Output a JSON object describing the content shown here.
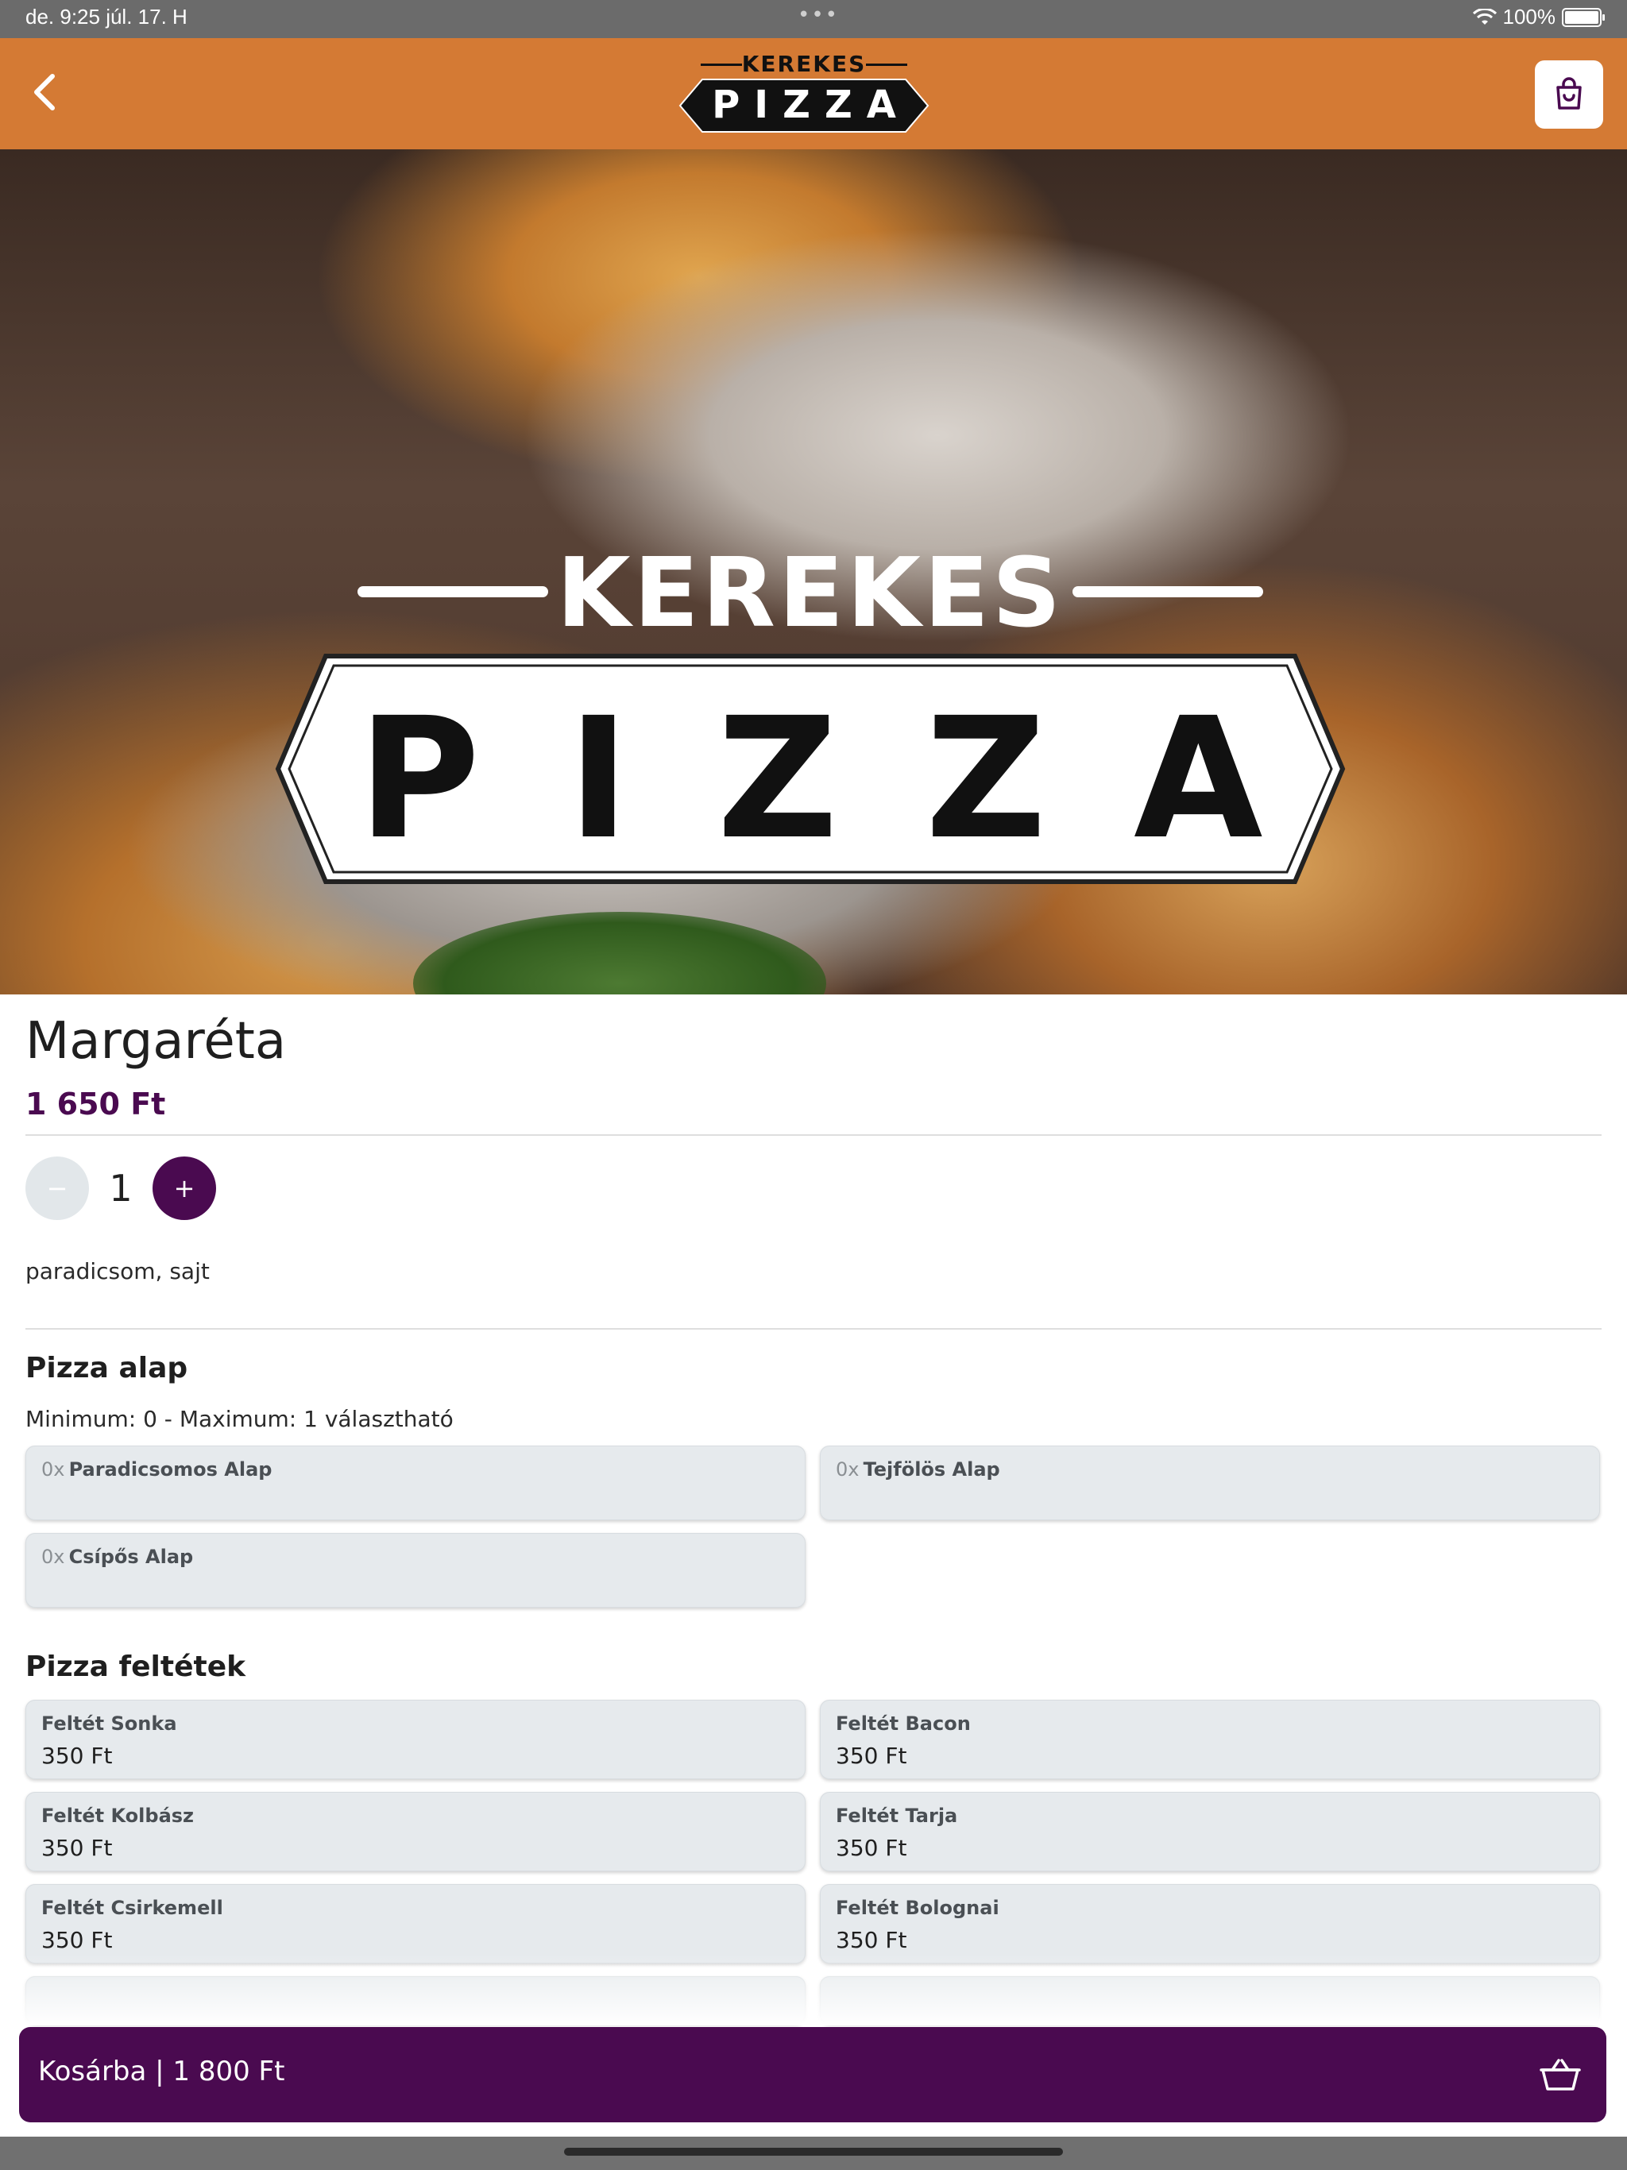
{
  "status_bar": {
    "time": "de. 9:25   júl. 17. H",
    "dots": "•••",
    "battery": "100%"
  },
  "header": {
    "logo_top": "KEREKES",
    "logo_main": "PIZZA"
  },
  "hero": {
    "logo_top": "KEREKES",
    "logo_main": "PIZZA"
  },
  "product": {
    "title": "Margaréta",
    "price": "1 650 Ft",
    "quantity": "1",
    "minus": "−",
    "plus": "+",
    "description": "paradicsom, sajt"
  },
  "base_section": {
    "title": "Pizza alap",
    "subtitle": "Minimum: 0 - Maximum: 1 választható",
    "options": [
      {
        "count": "0x",
        "name": "Paradicsomos Alap"
      },
      {
        "count": "0x",
        "name": "Tejfölös Alap"
      },
      {
        "count": "0x",
        "name": "Csípős Alap"
      }
    ]
  },
  "toppings_section": {
    "title": "Pizza feltétek",
    "options": [
      {
        "name": "Feltét Sonka",
        "price": "350 Ft"
      },
      {
        "name": "Feltét Bacon",
        "price": "350 Ft"
      },
      {
        "name": "Feltét Kolbász",
        "price": "350 Ft"
      },
      {
        "name": "Feltét Tarja",
        "price": "350 Ft"
      },
      {
        "name": "Feltét Csirkemell",
        "price": "350 Ft"
      },
      {
        "name": "Feltét Bolognai",
        "price": "350 Ft"
      }
    ]
  },
  "add_to_cart": {
    "label": "Kosárba | 1 800 Ft"
  },
  "colors": {
    "header": "#d47a34",
    "accent": "#4a0a50",
    "option_bg": "#e6eaed"
  }
}
